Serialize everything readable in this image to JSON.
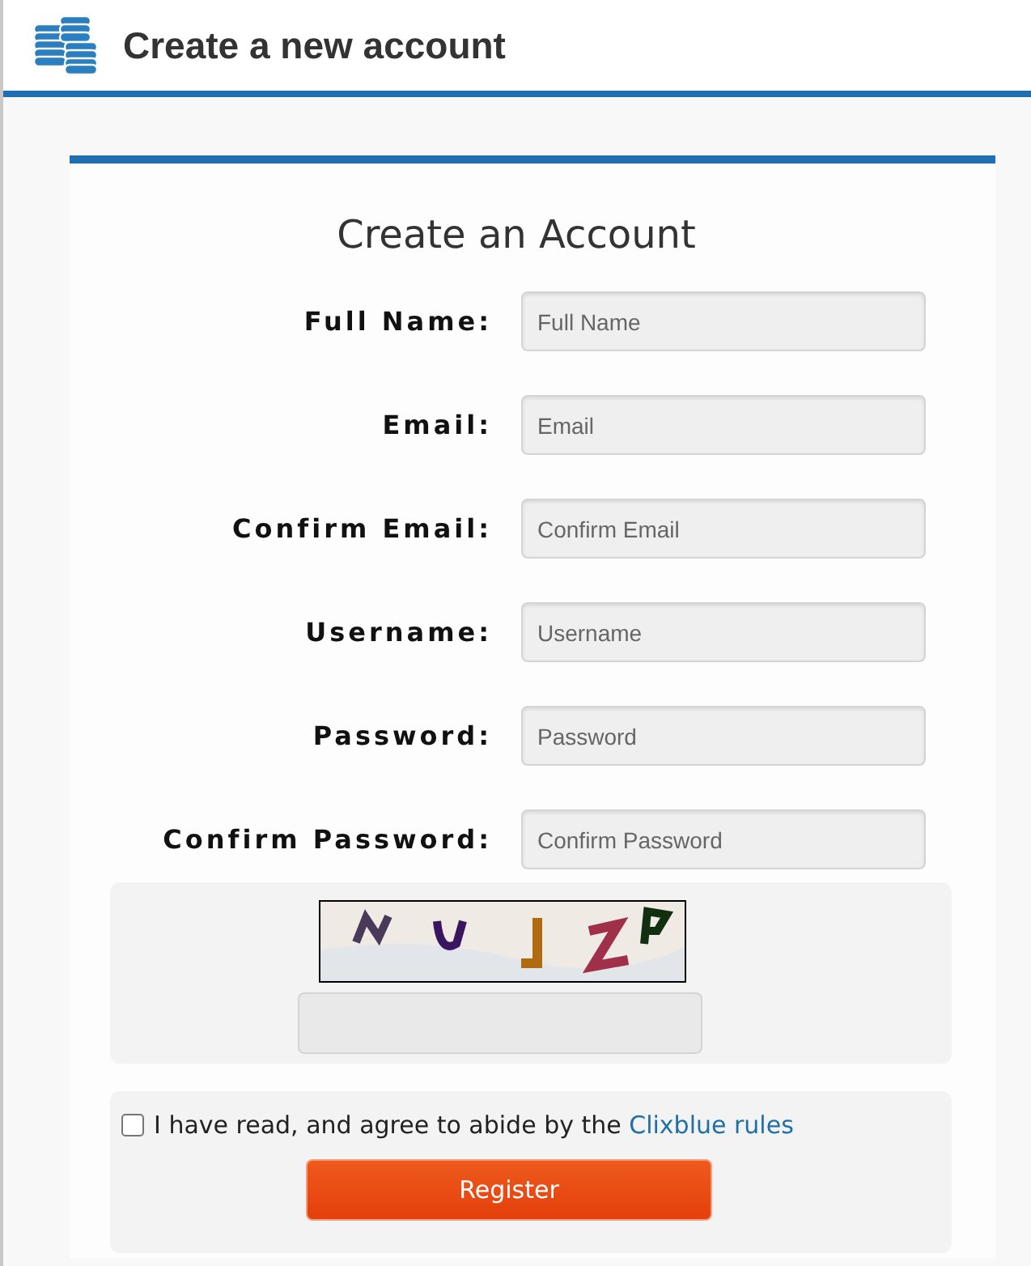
{
  "header": {
    "title": "Create a new account"
  },
  "form": {
    "title": "Create an Account",
    "fields": [
      {
        "label": "Full Name:",
        "placeholder": "Full Name"
      },
      {
        "label": "Email:",
        "placeholder": "Email"
      },
      {
        "label": "Confirm Email:",
        "placeholder": "Confirm Email"
      },
      {
        "label": "Username:",
        "placeholder": "Username"
      },
      {
        "label": "Password:",
        "placeholder": "Password"
      },
      {
        "label": "Confirm Password:",
        "placeholder": "Confirm Password"
      }
    ],
    "agree": {
      "checked": false,
      "text": "I have read, and agree to abide by the ",
      "link": "Clixblue rules"
    },
    "button": "Register"
  }
}
